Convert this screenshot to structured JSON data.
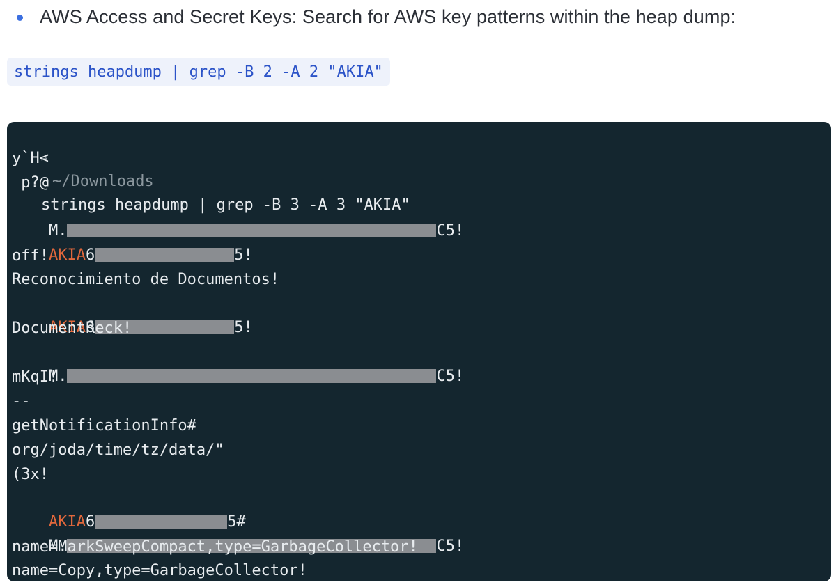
{
  "colors": {
    "bullet": "#3b6fe0",
    "snippet_bg": "#eef2fb",
    "snippet_text": "#2b53c8",
    "terminal_bg": "#14262f",
    "terminal_text": "#e8ecef",
    "prompt_dim": "#8b979e",
    "akia_highlight": "#e2683c"
  },
  "bullet": {
    "text": "AWS Access and Secret Keys: Search for AWS key patterns within the heap dump:"
  },
  "snippet": {
    "code": "strings heapdump | grep -B 2 -A 2 \"AKIA\""
  },
  "terminal": {
    "prompt_icon": "prompt-arrow-icon",
    "prompt_path": "~/Downloads",
    "command": "strings heapdump | grep -B 3 -A 3 \"AKIA\"",
    "lines": {
      "l1": "y`H<",
      "l2": " p?@",
      "l3_prefix": "M.",
      "l3_suffix": "C5!",
      "l4_prefix": "AKIA",
      "l4_mid": "6",
      "l4_suffix": "5!",
      "l5": "off!",
      "l6": "Reconocimiento de Documentos!",
      "l7_prefix": "AKIA",
      "l7_mid": "6",
      "l7_suffix": "5!",
      "l8": "DocumentReck!",
      "l9_prefix": "M.",
      "l9_suffix": "C5!",
      "l10": "mKqI!",
      "l11": "--",
      "l12": "getNotificationInfo#",
      "l13": "org/joda/time/tz/data/\"",
      "l14": "(3x!",
      "l15_prefix": "AKIA",
      "l15_mid": "6",
      "l15_suffix": "5#",
      "l16_prefix": "M.",
      "l16_suffix": "C5!",
      "l17": "name=MarkSweepCompact,type=GarbageCollector!",
      "l18": "name=Copy,type=GarbageCollector!"
    }
  }
}
